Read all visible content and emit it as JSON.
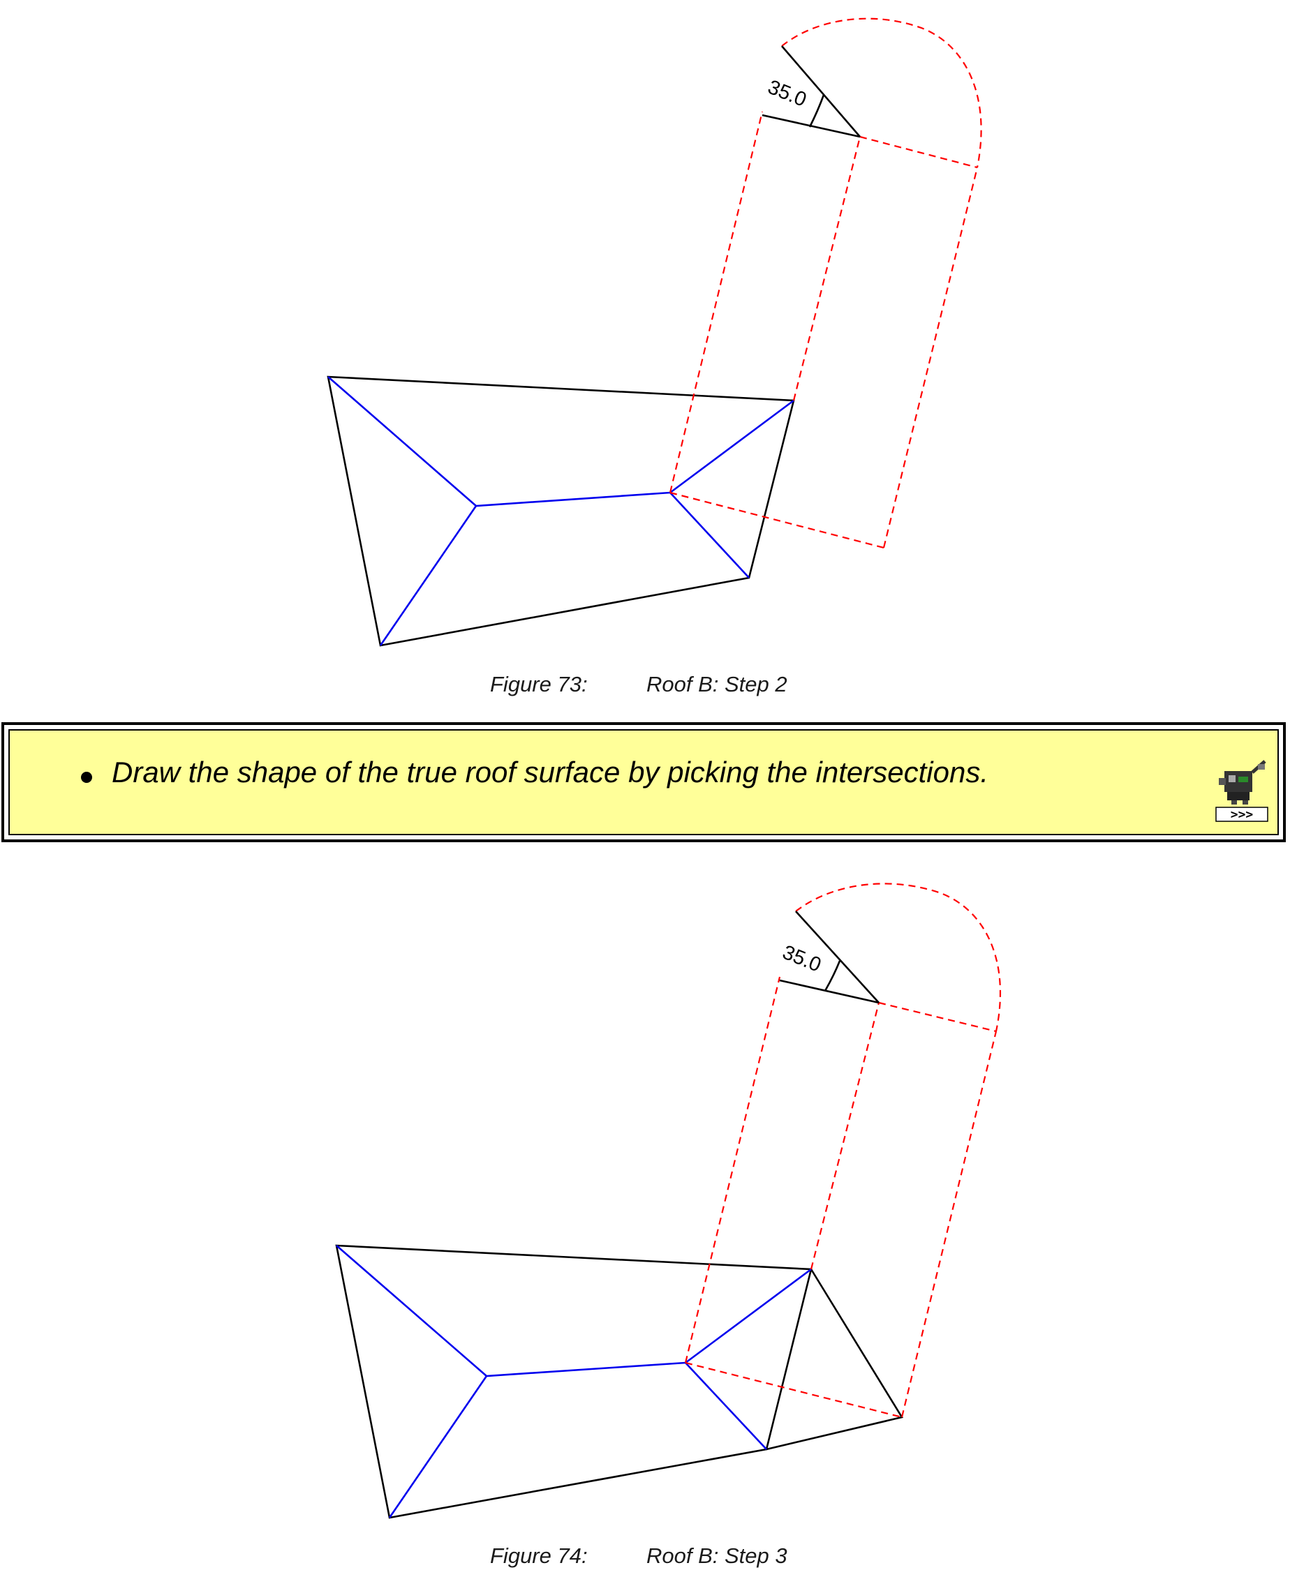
{
  "figures": [
    {
      "caption_number": "Figure 73:",
      "caption_text": "Roof B: Step 2",
      "angle_label": "35.0"
    },
    {
      "caption_number": "Figure 74:",
      "caption_text": "Roof B: Step 3",
      "angle_label": "35.0"
    }
  ],
  "note": {
    "text": "Draw the shape of the true roof surface by picking the intersections.",
    "icon": "tool-icon",
    "icon_label": ">>>"
  },
  "colors": {
    "roof_outline": "#000000",
    "hip_lines": "#0000ee",
    "construction_lines": "#ff0000",
    "note_background": "#ffff99"
  }
}
